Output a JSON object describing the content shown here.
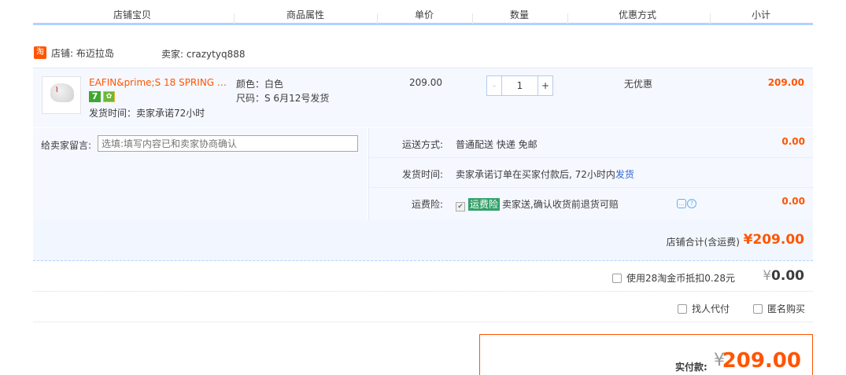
{
  "header": {
    "columns": [
      "店铺宝贝",
      "商品属性",
      "单价",
      "数量",
      "优惠方式",
      "小计"
    ]
  },
  "shop": {
    "badge": "淘",
    "name": "店铺: 布迈拉岛",
    "seller": "卖家: crazytyq888"
  },
  "item": {
    "title": "EAFIN&prime;S 18 SPRING &amp;...",
    "badge_seven": "7",
    "ship_time": "发货时间：卖家承诺72小时",
    "attr_color": "颜色：白色",
    "attr_size": "尺码：S 6月12号发货",
    "price": "209.00",
    "qty_minus": "-",
    "qty_value": "1",
    "qty_plus": "+",
    "promo": "无优惠",
    "subtotal": "209.00"
  },
  "message": {
    "label": "给卖家留言:",
    "placeholder": "选填:填写内容已和卖家协商确认"
  },
  "shipping": {
    "method_label": "运送方式:",
    "method_value": "普通配送 快递 免邮",
    "method_amount": "0.00",
    "time_label": "发货时间:",
    "time_value": "卖家承诺订单在买家付款后, 72小时内",
    "time_link": "发货",
    "ins_label": "运费险:",
    "ins_tag": "运费险",
    "ins_value": "卖家送,确认收货前退货可赔",
    "ins_amount": "0.00"
  },
  "shop_total": {
    "label": "店铺合计(含运费)",
    "value": "¥209.00"
  },
  "coins": {
    "label": "使用28淘金币抵扣0.28元",
    "yen": "¥",
    "value": "0.00"
  },
  "options": {
    "proxy_pay": "找人代付",
    "anonymous": "匿名购买"
  },
  "payment": {
    "label": "实付款:",
    "yen": "¥",
    "amount": "209.00"
  },
  "colors": {
    "accent": "#ff5500",
    "header_border": "#b2d1ff",
    "row_bg": "#f5f8ff"
  }
}
